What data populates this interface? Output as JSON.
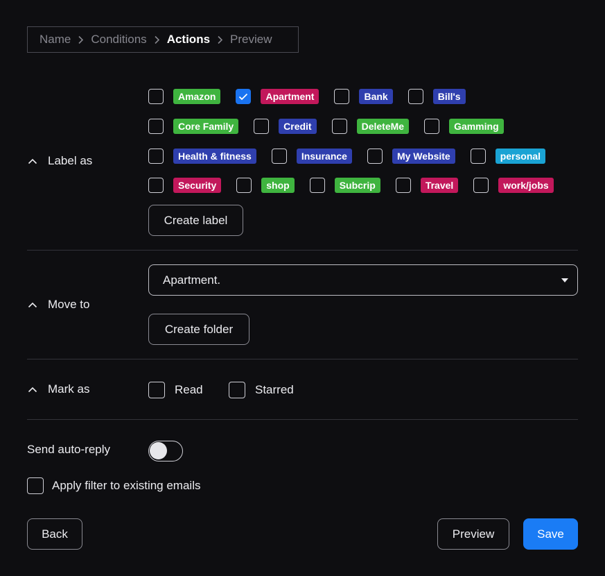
{
  "breadcrumb": {
    "steps": [
      "Name",
      "Conditions",
      "Actions",
      "Preview"
    ],
    "active_index": 2
  },
  "sections": {
    "label_as": "Label as",
    "move_to": "Move to",
    "mark_as": "Mark as"
  },
  "labels": [
    [
      {
        "name": "Amazon",
        "color": "#3fb43f",
        "checked": false
      },
      {
        "name": "Apartment",
        "color": "#c2185b",
        "checked": true
      },
      {
        "name": "Bank",
        "color": "#2f3fae",
        "checked": false
      },
      {
        "name": "Bill's",
        "color": "#2f3fae",
        "checked": false
      }
    ],
    [
      {
        "name": "Core Family",
        "color": "#3fb43f",
        "checked": false
      },
      {
        "name": "Credit",
        "color": "#2f3fae",
        "checked": false
      },
      {
        "name": "DeleteMe",
        "color": "#3fb43f",
        "checked": false
      },
      {
        "name": "Gamming",
        "color": "#3fb43f",
        "checked": false
      }
    ],
    [
      {
        "name": "Health & fitness",
        "color": "#2f3fae",
        "checked": false
      },
      {
        "name": "Insurance",
        "color": "#2f3fae",
        "checked": false
      },
      {
        "name": "My Website",
        "color": "#2f3fae",
        "checked": false
      },
      {
        "name": "personal",
        "color": "#1aa3d4",
        "checked": false
      }
    ],
    [
      {
        "name": "Security",
        "color": "#c2185b",
        "checked": false
      },
      {
        "name": "shop",
        "color": "#3fb43f",
        "checked": false
      },
      {
        "name": "Subcrip",
        "color": "#3fb43f",
        "checked": false
      },
      {
        "name": "Travel",
        "color": "#c2185b",
        "checked": false
      },
      {
        "name": "work/jobs",
        "color": "#c2185b",
        "checked": false
      }
    ]
  ],
  "buttons": {
    "create_label": "Create label",
    "create_folder": "Create folder",
    "back": "Back",
    "preview": "Preview",
    "save": "Save"
  },
  "move_to": {
    "selected": "Apartment."
  },
  "mark_as": {
    "read": "Read",
    "starred": "Starred"
  },
  "auto_reply": {
    "label": "Send auto-reply",
    "enabled": false
  },
  "apply_existing": {
    "label": "Apply filter to existing emails",
    "checked": false
  },
  "colors": {
    "accent": "#1a7cf5",
    "background": "#0e0e11"
  },
  "icons": {
    "breadcrumb_separator": "chevron-right-icon",
    "section_toggle": "chevron-up-icon",
    "select_arrow": "caret-down-icon",
    "check": "check-icon"
  }
}
